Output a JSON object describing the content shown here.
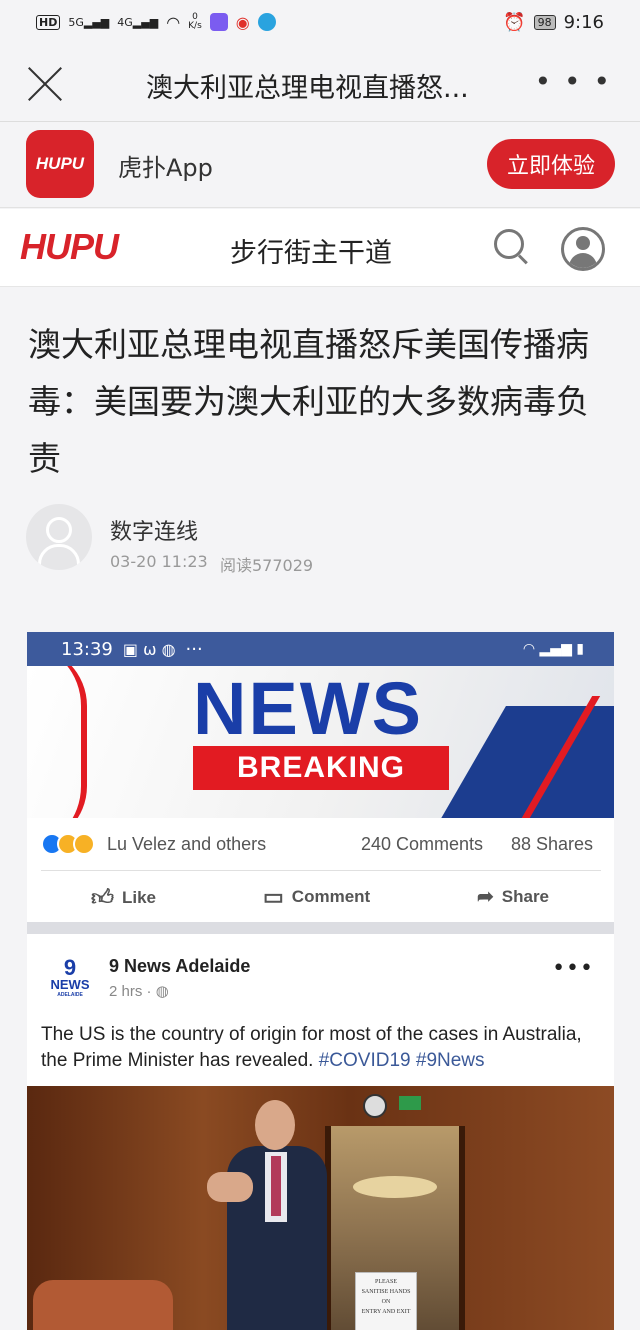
{
  "status_bar": {
    "left_badges": [
      "HD",
      "5G",
      "4G"
    ],
    "net_speed_value": "0",
    "net_speed_unit": "K/s",
    "battery": "98",
    "time": "9:16"
  },
  "titlebar": {
    "title": "澳大利亚总理电视直播怒..."
  },
  "app_banner": {
    "logo_text": "HUPU",
    "app_name": "虎扑App",
    "button_label": "立即体验"
  },
  "site_header": {
    "logo_text": "HUPU",
    "section": "步行街主干道"
  },
  "article": {
    "title": "澳大利亚总理电视直播怒斥美国传播病毒：美国要为澳大利亚的大多数病毒负责",
    "author": "数字连线",
    "time": "03-20 11:23",
    "reads": "阅读577029"
  },
  "embed": {
    "status_time": "13:39",
    "status_dots": "···",
    "news_word": "NEWS",
    "breaking_word": "BREAKING",
    "reaction_names": "Lu Velez and others",
    "comments": "240 Comments",
    "shares": "88 Shares",
    "like_label": "Like",
    "comment_label": "Comment",
    "share_label": "Share",
    "page_logo_top": "9",
    "page_logo_bottom": "NEWS",
    "page_logo_sub": "ADELAIDE",
    "page_name": "9 News Adelaide",
    "post_age": "2 hrs · ",
    "post_text": "The US is the country of origin for most of the cases in Australia, the Prime Minister has revealed. ",
    "post_tags": "#COVID19 #9News",
    "sign_text": [
      "PLEASE",
      "SANITISE HANDS",
      "ON",
      "ENTRY AND EXIT"
    ]
  },
  "colors": {
    "brand_red": "#d8232a",
    "fb_blue": "#3d5a9c",
    "news_blue": "#1a3ea8"
  }
}
